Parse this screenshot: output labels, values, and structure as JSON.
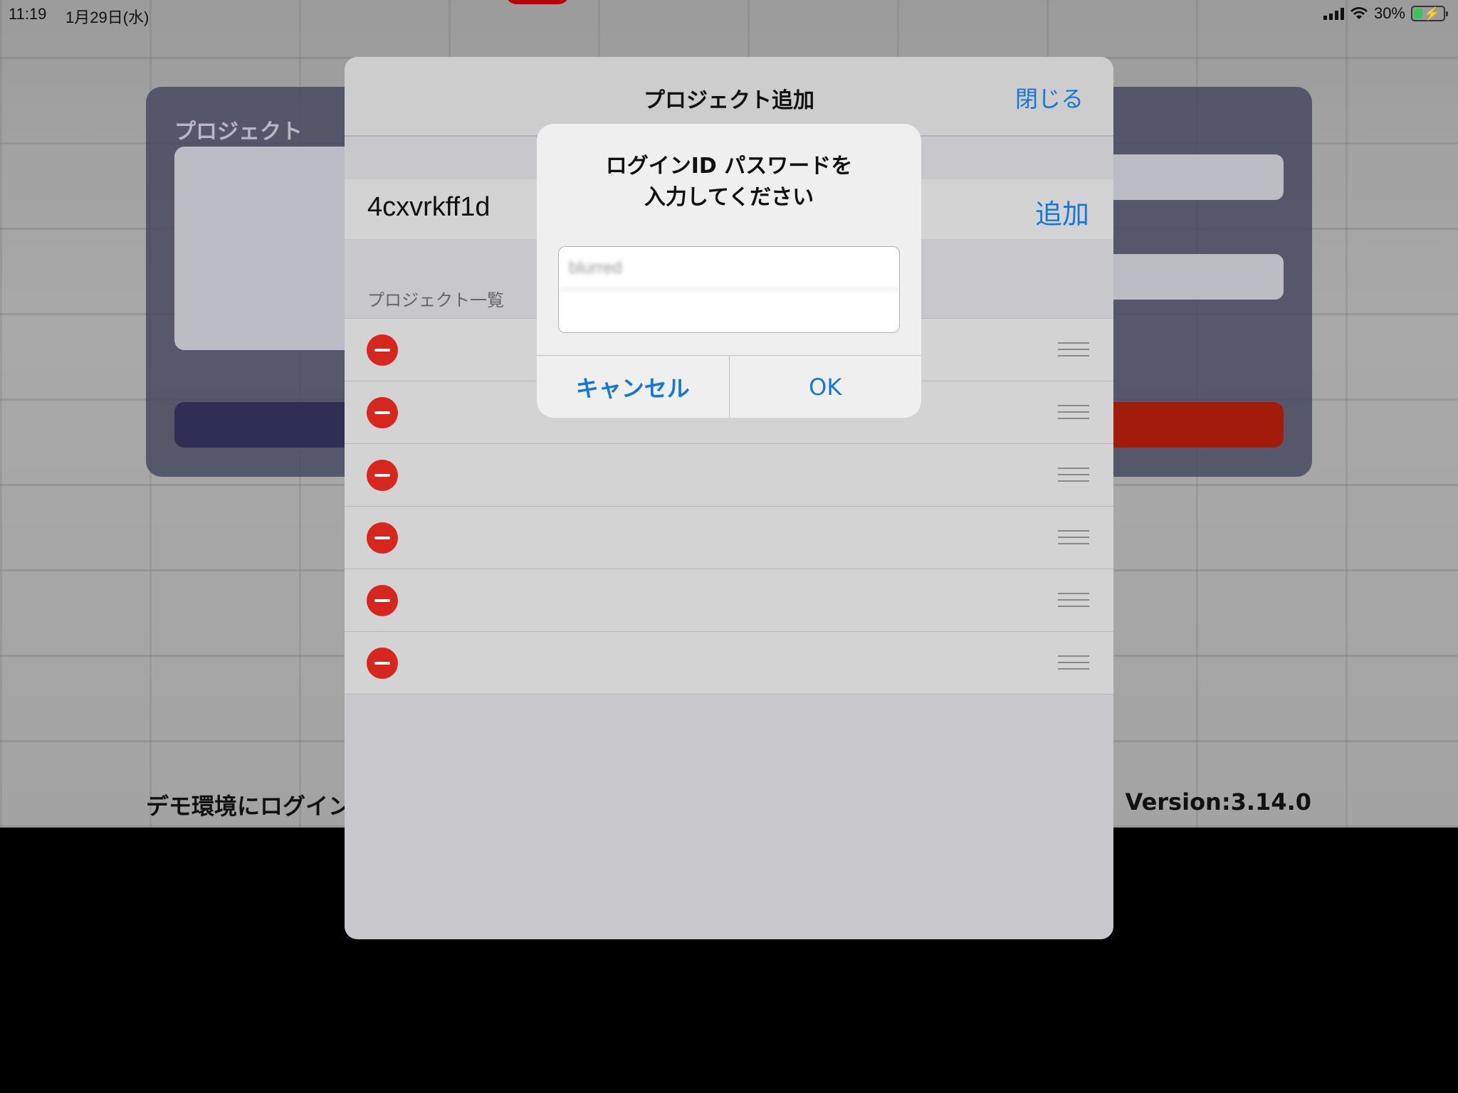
{
  "status_bar": {
    "time": "11:19",
    "date": "1月29日(水)",
    "battery": "30%",
    "battery_level": 0.3
  },
  "background": {
    "project_label": "プロジェクト",
    "demo_link": "デモ環境にログイン",
    "version": "Version:3.14.0"
  },
  "modal": {
    "title": "プロジェクト追加",
    "close_label": "閉じる",
    "project_id_value": "4cxvrkff1d",
    "add_label": "追加",
    "list_header": "プロジェクト一覧",
    "list_rows": [
      "",
      "",
      "",
      "",
      "",
      ""
    ]
  },
  "alert": {
    "title_line1": "ログインID パスワードを",
    "title_line2": "入力してください",
    "login_id_value": "blurred",
    "password_value": "",
    "cancel_label": "キャンセル",
    "ok_label": "OK"
  },
  "colors": {
    "accent": "#1677d8",
    "delete": "#d7261e",
    "login_button": "#a31b0a"
  }
}
